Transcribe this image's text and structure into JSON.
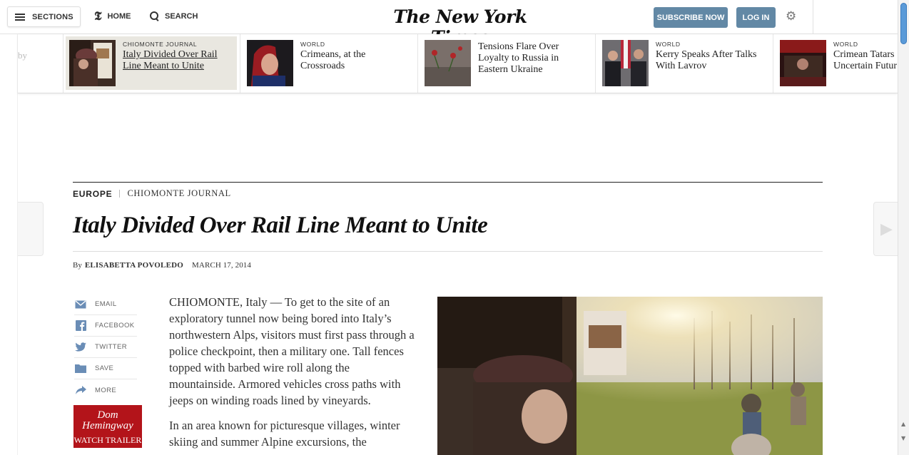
{
  "topbar": {
    "sections_label": "SECTIONS",
    "home_label": "HOME",
    "search_label": "SEARCH",
    "masthead": "The New York Times",
    "subscribe_label": "SUBSCRIBE NOW",
    "login_label": "LOG IN",
    "settings_icon": "gear-icon"
  },
  "ribbon": {
    "edge_text": "by",
    "items": [
      {
        "kicker": "CHIOMONTE JOURNAL",
        "headline_lines": [
          "Italy Divided Over Rail",
          "Line Meant to Unite"
        ],
        "active": true
      },
      {
        "kicker": "WORLD",
        "headline_lines": [
          "Crimeans, at the",
          "Crossroads"
        ],
        "active": false
      },
      {
        "kicker": "",
        "headline_lines": [
          "Tensions Flare Over",
          "Loyalty to Russia in",
          "Eastern Ukraine"
        ],
        "active": false
      },
      {
        "kicker": "WORLD",
        "headline_lines": [
          "Kerry Speaks After Talks",
          "With Lavrov"
        ],
        "active": false
      },
      {
        "kicker": "WORLD",
        "headline_lines": [
          "Crimean Tatars",
          "Uncertain Futur"
        ],
        "active": false
      }
    ]
  },
  "article": {
    "section": "EUROPE",
    "subsection": "CHIOMONTE JOURNAL",
    "headline": "Italy Divided Over Rail Line Meant to Unite",
    "byline_prefix": "By",
    "author": "ELISABETTA POVOLEDO",
    "date": "MARCH 17, 2014",
    "paragraphs": [
      "CHIOMONTE, Italy — To get to the site of an exploratory tunnel now being bored into Italy’s northwestern Alps, visitors must first pass through a police checkpoint, then a military one. Tall fences topped with barbed wire roll along the mountainside. Armored vehicles cross paths with jeeps on winding roads lined by vineyards.",
      "In an area known for picturesque villages, winter skiing and summer Alpine excursions, the"
    ]
  },
  "share": [
    {
      "label": "EMAIL",
      "icon": "email-icon"
    },
    {
      "label": "FACEBOOK",
      "icon": "facebook-icon"
    },
    {
      "label": "TWITTER",
      "icon": "twitter-icon"
    },
    {
      "label": "SAVE",
      "icon": "save-icon"
    },
    {
      "label": "MORE",
      "icon": "share-arrow-icon"
    }
  ],
  "ad": {
    "title_lines": [
      "Dom",
      "Hemingway"
    ],
    "cta": "WATCH TRAILER"
  },
  "colors": {
    "accent_button": "#6288a5",
    "share_icon": "#6a8db6",
    "ad_red": "#b3141a",
    "active_ribbon_bg": "#e9e7e0"
  }
}
